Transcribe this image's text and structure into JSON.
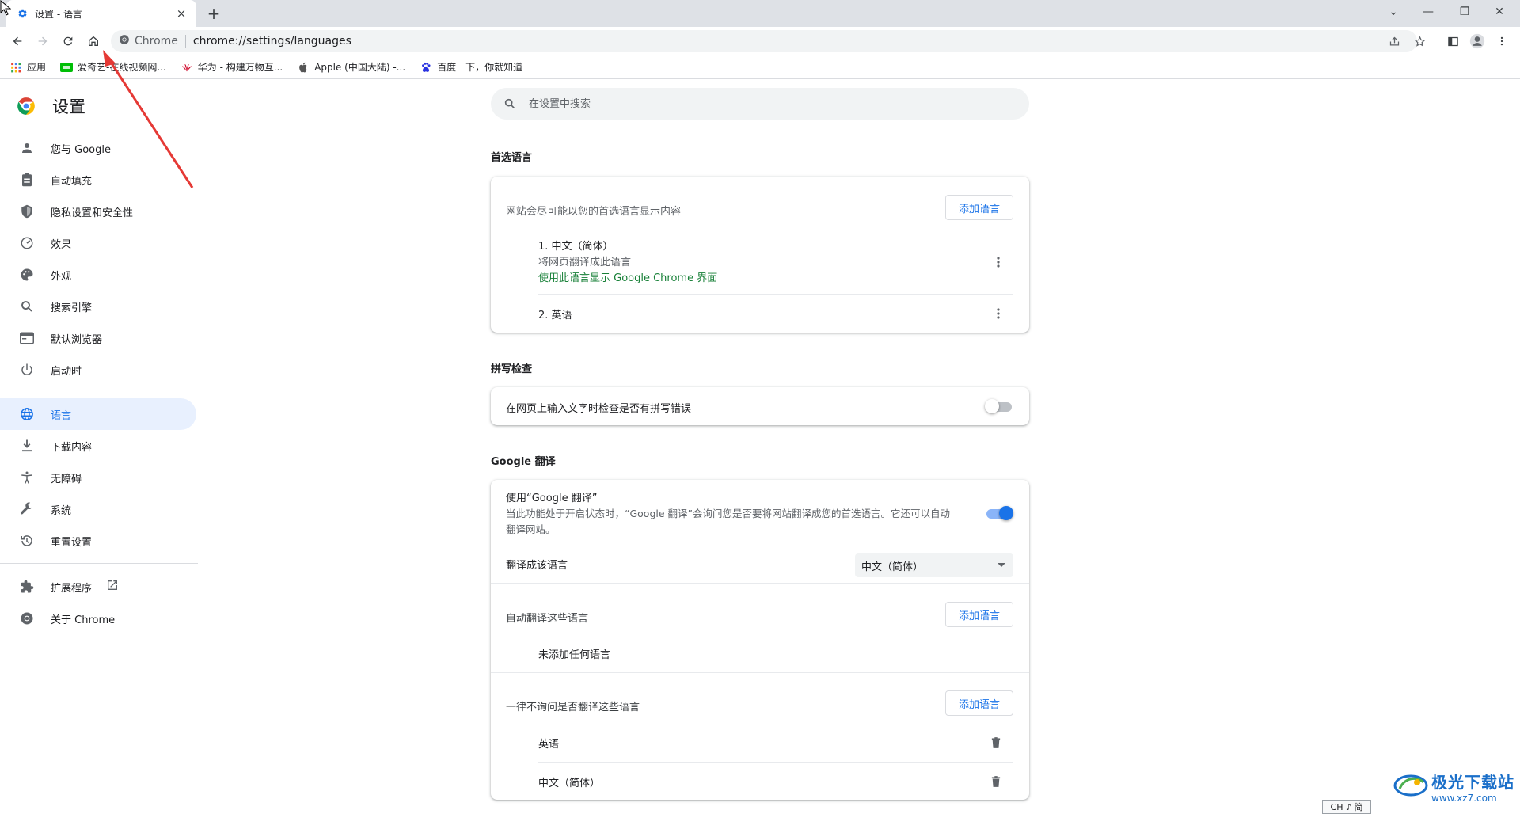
{
  "tab": {
    "title": "设置 - 语言",
    "close": "×",
    "new_tab": "+"
  },
  "window_controls": {
    "tabsearch": "⌄",
    "minimize": "—",
    "restore": "❐",
    "close": "✕"
  },
  "omnibox": {
    "chip": "Chrome",
    "url": "chrome://settings/languages"
  },
  "bookmarks": [
    {
      "label": "应用"
    },
    {
      "label": "爱奇艺-在线视频网..."
    },
    {
      "label": "华为 - 构建万物互..."
    },
    {
      "label": "Apple (中国大陆) -..."
    },
    {
      "label": "百度一下，你就知道"
    }
  ],
  "sidebar": {
    "title": "设置",
    "items": [
      {
        "label": "您与 Google",
        "icon": "person-icon"
      },
      {
        "label": "自动填充",
        "icon": "clipboard-icon"
      },
      {
        "label": "隐私设置和安全性",
        "icon": "shield-icon"
      },
      {
        "label": "效果",
        "icon": "speedometer-icon"
      },
      {
        "label": "外观",
        "icon": "palette-icon"
      },
      {
        "label": "搜索引擎",
        "icon": "search-icon"
      },
      {
        "label": "默认浏览器",
        "icon": "browser-icon"
      },
      {
        "label": "启动时",
        "icon": "power-icon"
      },
      {
        "label": "语言",
        "icon": "globe-icon",
        "active": true
      },
      {
        "label": "下载内容",
        "icon": "download-icon"
      },
      {
        "label": "无障碍",
        "icon": "accessibility-icon"
      },
      {
        "label": "系统",
        "icon": "wrench-icon"
      },
      {
        "label": "重置设置",
        "icon": "history-icon"
      },
      {
        "label": "扩展程序",
        "icon": "puzzle-icon"
      },
      {
        "label": "关于 Chrome",
        "icon": "chrome-icon"
      }
    ]
  },
  "search": {
    "placeholder": "在设置中搜索"
  },
  "preferred": {
    "section_title": "首选语言",
    "description": "网站会尽可能以您的首选语言显示内容",
    "add_button": "添加语言",
    "lang1": {
      "name": "1. 中文（简体）",
      "sub": "将网页翻译成此语言",
      "ui_note": "使用此语言显示 Google Chrome 界面"
    },
    "lang2": {
      "name": "2. 英语"
    }
  },
  "spellcheck": {
    "section_title": "拼写检查",
    "label": "在网页上输入文字时检查是否有拼写错误",
    "enabled": false
  },
  "translate": {
    "section_title": "Google 翻译",
    "use_label": "使用“Google 翻译”",
    "use_desc_line1": "当此功能处于开启状态时，“Google 翻译”会询问您是否要将网站翻译成您的首选语言。它还可以自动",
    "use_desc_line2": "翻译网站。",
    "enabled": true,
    "target_label": "翻译成该语言",
    "target_value": "中文（简体）",
    "auto_label": "自动翻译这些语言",
    "auto_add": "添加语言",
    "auto_empty": "未添加任何语言",
    "never_label": "一律不询问是否翻译这些语言",
    "never_add": "添加语言",
    "never_list": [
      "英语",
      "中文（简体）"
    ]
  },
  "colors": {
    "accent": "#1a73e8",
    "green_note": "#188038",
    "annotation": "#e53935"
  },
  "watermark": {
    "title": "极光下载站",
    "url": "www.xz7.com"
  },
  "ime": {
    "label": "CH ♪ 简"
  }
}
